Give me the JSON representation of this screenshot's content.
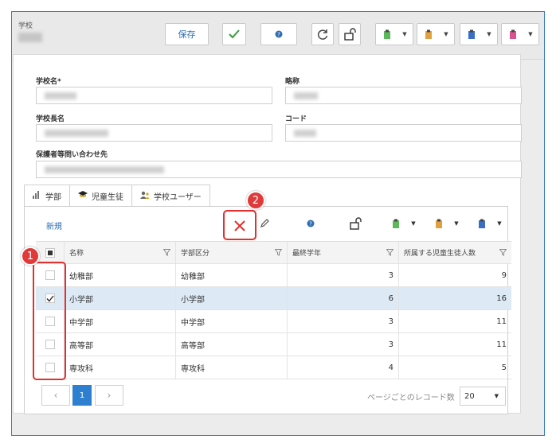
{
  "header": {
    "title": "学校",
    "save_label": "保存"
  },
  "form": {
    "school_name_label": "学校名*",
    "short_name_label": "略称",
    "principal_label": "学校長名",
    "code_label": "コード",
    "guardian_contact_label": "保護者等問い合わせ先"
  },
  "tabs": [
    {
      "label": "学部",
      "icon": "bar-chart-icon"
    },
    {
      "label": "児童生徒",
      "icon": "graduation-cap-icon"
    },
    {
      "label": "学校ユーザー",
      "icon": "users-icon"
    }
  ],
  "toolbar": {
    "new_label": "新規"
  },
  "grid": {
    "columns": [
      "名称",
      "学部区分",
      "最終学年",
      "所属する児童生徒人数"
    ],
    "rows": [
      {
        "name": "幼稚部",
        "category": "幼稚部",
        "last_grade": "3",
        "students": "9",
        "checked": false
      },
      {
        "name": "小学部",
        "category": "小学部",
        "last_grade": "6",
        "students": "16",
        "checked": true
      },
      {
        "name": "中学部",
        "category": "中学部",
        "last_grade": "3",
        "students": "11",
        "checked": false
      },
      {
        "name": "高等部",
        "category": "高等部",
        "last_grade": "3",
        "students": "11",
        "checked": false
      },
      {
        "name": "専攻科",
        "category": "専攻科",
        "last_grade": "4",
        "students": "5",
        "checked": false
      }
    ]
  },
  "pager": {
    "current_page": "1",
    "per_page_label": "ページごとのレコード数",
    "per_page_value": "20"
  },
  "callouts": [
    "1",
    "2"
  ],
  "colors": {
    "accent": "#2f7fd0",
    "callout": "#e03030"
  }
}
